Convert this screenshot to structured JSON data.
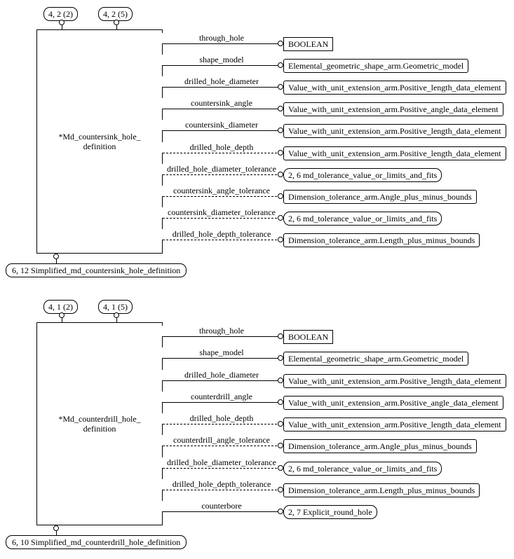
{
  "countersink": {
    "boxLabel": "*Md_countersink_hole_\ndefinition",
    "pageRefs": [
      "4, 2 (2)",
      "4, 2 (5)"
    ],
    "subLabel": "6, 12 Simplified_md_countersink_hole_definition",
    "attrs": [
      {
        "name": "through_hole",
        "target": "BOOLEAN",
        "kind": "sq",
        "optional": false
      },
      {
        "name": "shape_model",
        "target": "Elemental_geometric_shape_arm.Geometric_model",
        "kind": "rd",
        "optional": false
      },
      {
        "name": "drilled_hole_diameter",
        "target": "Value_with_unit_extension_arm.Positive_length_data_element",
        "kind": "rd",
        "optional": false
      },
      {
        "name": "countersink_angle",
        "target": "Value_with_unit_extension_arm.Positive_angle_data_element",
        "kind": "rd",
        "optional": false
      },
      {
        "name": "countersink_diameter",
        "target": "Value_with_unit_extension_arm.Positive_length_data_element",
        "kind": "rd",
        "optional": false
      },
      {
        "name": "drilled_hole_depth",
        "target": "Value_with_unit_extension_arm.Positive_length_data_element",
        "kind": "rd",
        "optional": true
      },
      {
        "name": "drilled_hole_diameter_tolerance",
        "target": "2, 6 md_tolerance_value_or_limits_and_fits",
        "kind": "cap",
        "optional": true
      },
      {
        "name": "countersink_angle_tolerance",
        "target": "Dimension_tolerance_arm.Angle_plus_minus_bounds",
        "kind": "rd",
        "optional": true
      },
      {
        "name": "countersink_diameter_tolerance",
        "target": "2, 6 md_tolerance_value_or_limits_and_fits",
        "kind": "cap",
        "optional": true
      },
      {
        "name": "drilled_hole_depth_tolerance",
        "target": "Dimension_tolerance_arm.Length_plus_minus_bounds",
        "kind": "rd",
        "optional": true
      }
    ]
  },
  "counterdrill": {
    "boxLabel": "*Md_counterdrill_hole_\ndefinition",
    "pageRefs": [
      "4, 1 (2)",
      "4, 1 (5)"
    ],
    "subLabel": "6, 10 Simplified_md_counterdrill_hole_definition",
    "attrs": [
      {
        "name": "through_hole",
        "target": "BOOLEAN",
        "kind": "sq",
        "optional": false
      },
      {
        "name": "shape_model",
        "target": "Elemental_geometric_shape_arm.Geometric_model",
        "kind": "rd",
        "optional": false
      },
      {
        "name": "drilled_hole_diameter",
        "target": "Value_with_unit_extension_arm.Positive_length_data_element",
        "kind": "rd",
        "optional": false
      },
      {
        "name": "counterdrill_angle",
        "target": "Value_with_unit_extension_arm.Positive_angle_data_element",
        "kind": "rd",
        "optional": false
      },
      {
        "name": "drilled_hole_depth",
        "target": "Value_with_unit_extension_arm.Positive_length_data_element",
        "kind": "rd",
        "optional": true
      },
      {
        "name": "counterdrill_angle_tolerance",
        "target": "Dimension_tolerance_arm.Angle_plus_minus_bounds",
        "kind": "rd",
        "optional": true
      },
      {
        "name": "drilled_hole_diameter_tolerance",
        "target": "2, 6 md_tolerance_value_or_limits_and_fits",
        "kind": "cap",
        "optional": true
      },
      {
        "name": "drilled_hole_depth_tolerance",
        "target": "Dimension_tolerance_arm.Length_plus_minus_bounds",
        "kind": "rd",
        "optional": true
      },
      {
        "name": "counterbore",
        "target": "2, 7 Explicit_round_hole",
        "kind": "cap",
        "optional": false
      }
    ]
  }
}
